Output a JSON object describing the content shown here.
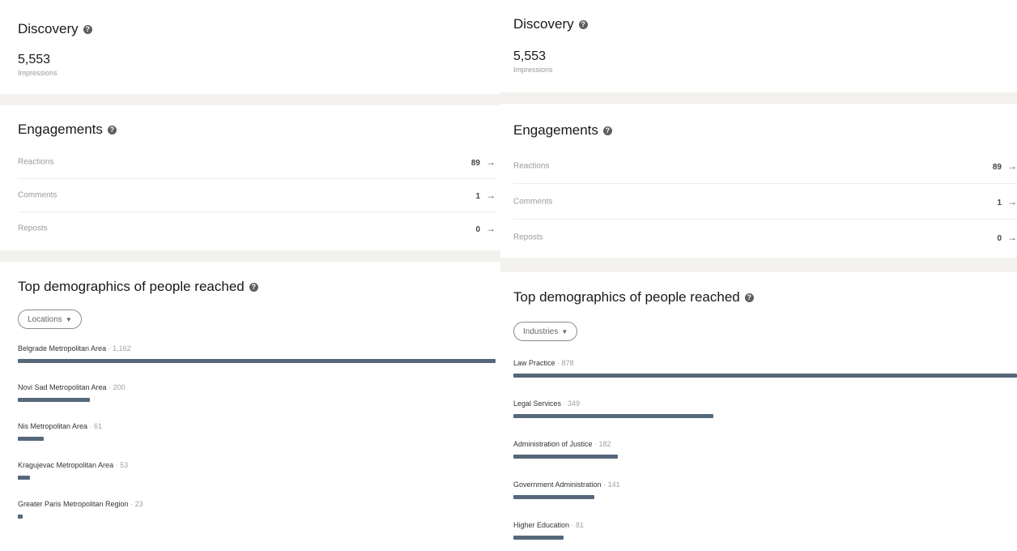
{
  "left": {
    "discovery": {
      "title": "Discovery",
      "value": "5,553",
      "label": "Impressions"
    },
    "engagements": {
      "title": "Engagements",
      "rows": [
        {
          "label": "Reactions",
          "value": "89"
        },
        {
          "label": "Comments",
          "value": "1"
        },
        {
          "label": "Reposts",
          "value": "0"
        }
      ]
    },
    "demographics": {
      "title": "Top demographics of people reached",
      "filter": "Locations",
      "items": [
        {
          "name": "Belgrade Metropolitan Area",
          "separator": " · ",
          "count": "1,162",
          "fraction": 1.0
        },
        {
          "name": "Novi Sad Metropolitan Area",
          "separator": " · ",
          "count": "200",
          "fraction": 0.15
        },
        {
          "name": "Nis Metropolitan Area",
          "separator": " · ",
          "count": "61",
          "fraction": 0.055
        },
        {
          "name": "Kragujevac Metropolitan Area",
          "separator": " · ",
          "count": "53",
          "fraction": 0.025
        },
        {
          "name": "Greater Paris Metropolitan Region",
          "separator": " · ",
          "count": "23",
          "fraction": 0.01
        }
      ]
    }
  },
  "right": {
    "discovery": {
      "title": "Discovery",
      "value": "5,553",
      "label": "Impressions"
    },
    "engagements": {
      "title": "Engagements",
      "rows": [
        {
          "label": "Reactions",
          "value": "89"
        },
        {
          "label": "Comments",
          "value": "1"
        },
        {
          "label": "Reposts",
          "value": "0"
        }
      ]
    },
    "demographics": {
      "title": "Top demographics of people reached",
      "filter": "Industries",
      "items": [
        {
          "name": "Law Practice",
          "separator": " · ",
          "count": "878",
          "fraction": 1.0
        },
        {
          "name": "Legal Services",
          "separator": " · ",
          "count": "349",
          "fraction": 0.397
        },
        {
          "name": "Administration of Justice",
          "separator": " · ",
          "count": "182",
          "fraction": 0.207
        },
        {
          "name": "Government Administration",
          "separator": " · ",
          "count": "141",
          "fraction": 0.16
        },
        {
          "name": "Higher Education",
          "separator": " · ",
          "count": "81",
          "fraction": 0.1
        }
      ]
    }
  },
  "icons": {
    "help": "help-circle-icon",
    "arrow": "arrow-right-icon",
    "caret": "caret-down-icon"
  },
  "colors": {
    "bar": "#56687a",
    "page_bg": "#f3f2ef"
  }
}
